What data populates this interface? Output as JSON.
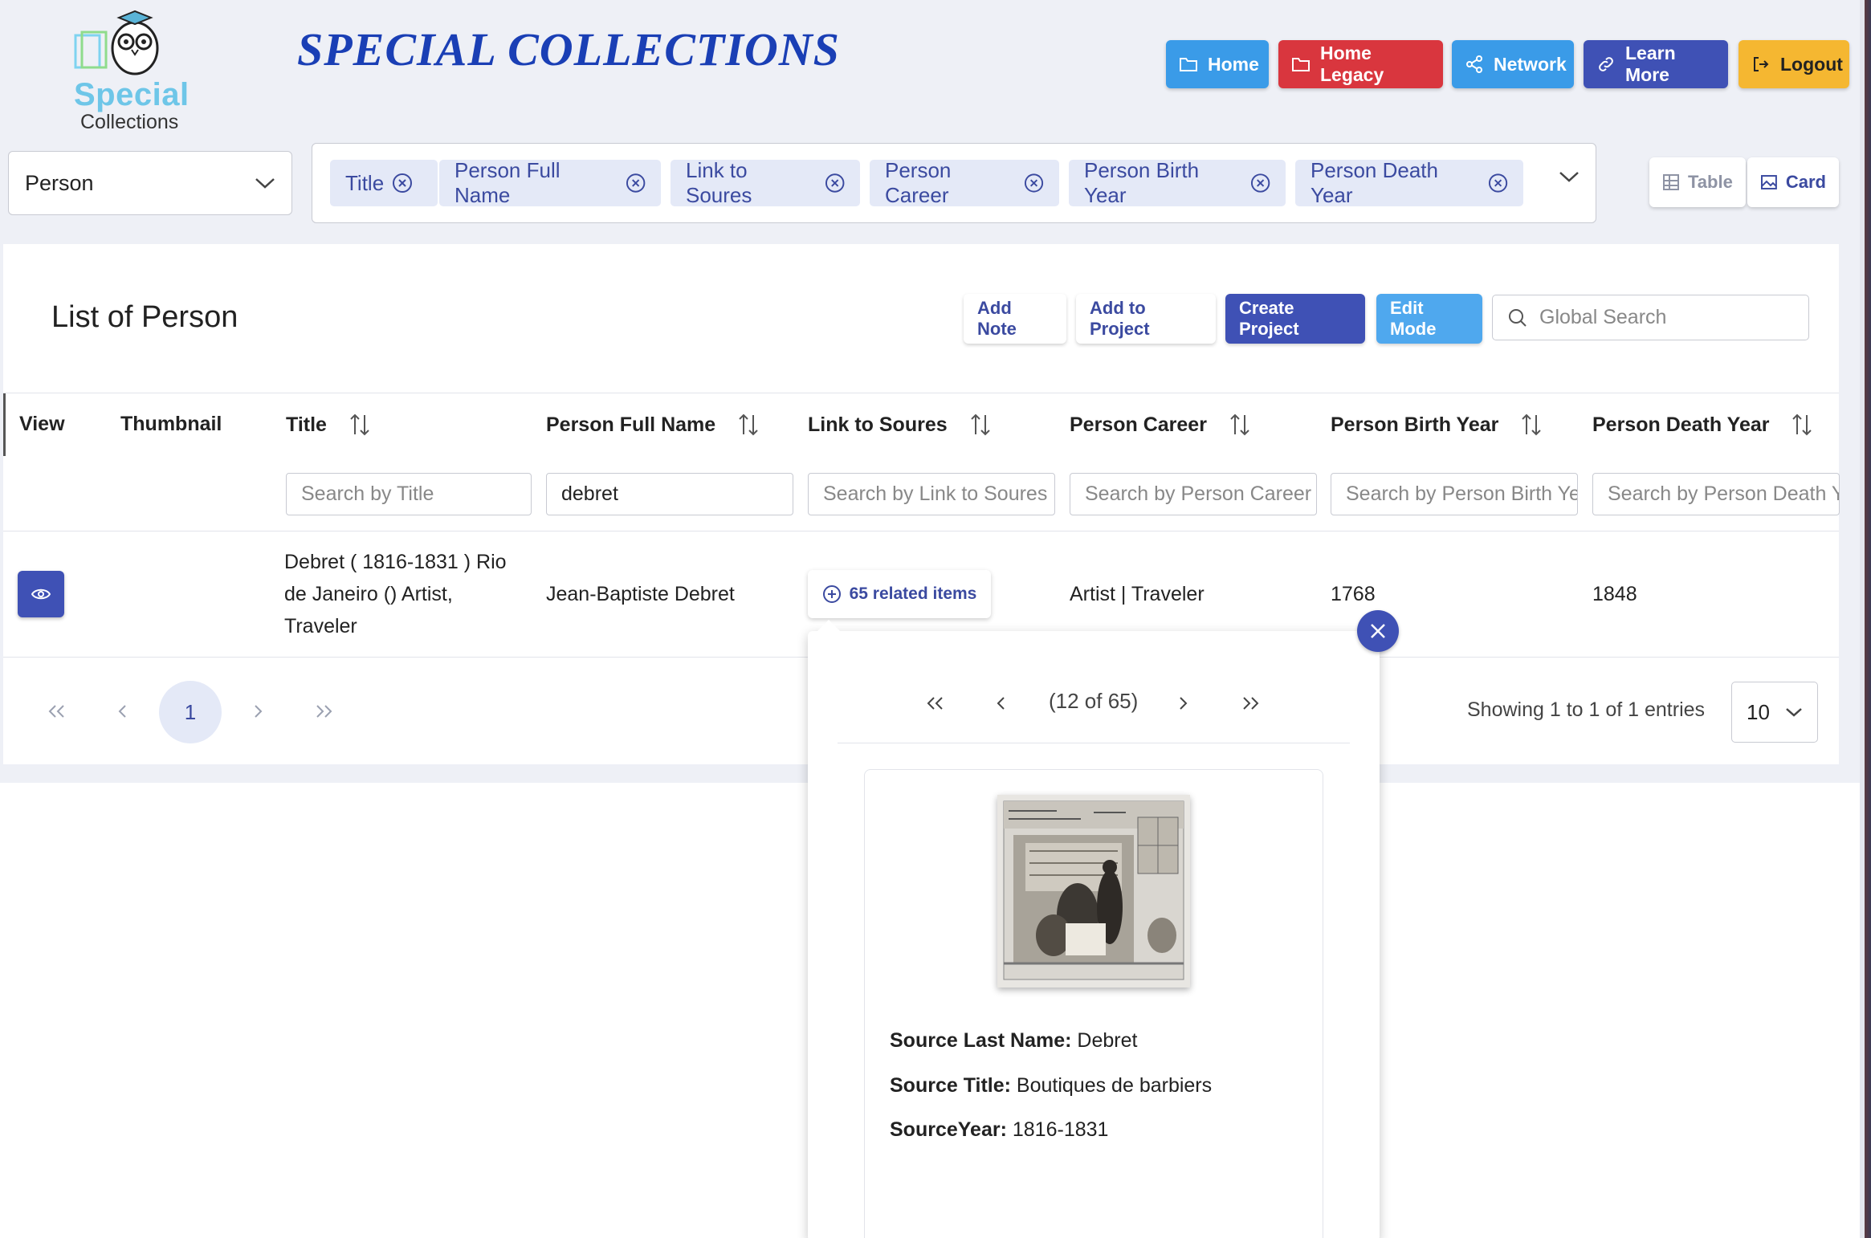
{
  "header": {
    "logo_word": "Special",
    "logo_sub": "Collections",
    "site_title": "SPECIAL COLLECTIONS",
    "nav": [
      {
        "label": "Home",
        "icon": "folder-icon",
        "color": "#3a9be8"
      },
      {
        "label": "Home Legacy",
        "icon": "folder-icon",
        "color": "#d9363e"
      },
      {
        "label": "Network",
        "icon": "share-icon",
        "color": "#3a9be8"
      },
      {
        "label": "Learn More",
        "icon": "link-icon",
        "color": "#3f51b5"
      },
      {
        "label": "Logout",
        "icon": "logout-icon",
        "color": "#f5b731"
      }
    ]
  },
  "toolbar": {
    "entity": "Person",
    "columns_chips": [
      "Title",
      "Person Full Name",
      "Link to Soures",
      "Person Career",
      "Person Birth Year",
      "Person Death Year"
    ],
    "view_table": "Table",
    "view_card": "Card"
  },
  "list": {
    "title": "List of Person",
    "add_note": "Add Note",
    "add_to_project": "Add to Project",
    "create_project": "Create Project",
    "edit_mode": "Edit Mode",
    "global_search_placeholder": "Global Search"
  },
  "table": {
    "headers": {
      "view": "View",
      "thumbnail": "Thumbnail",
      "title": "Title",
      "full_name": "Person Full Name",
      "link": "Link to Soures",
      "career": "Person Career",
      "birth": "Person Birth Year",
      "death": "Person Death Year"
    },
    "filters": {
      "title": "Search by Title",
      "full_name_value": "debret",
      "link": "Search by Link to Soures",
      "career": "Search by Person Career",
      "birth": "Search by Person Birth Ye",
      "death": "Search by Person Death Y"
    },
    "rows": [
      {
        "title_l1": "Debret ( 1816-1831 ) Rio",
        "title_l2": "de Janeiro () Artist,",
        "title_l3": "Traveler",
        "full_name": "Jean-Baptiste Debret",
        "related": "65 related items",
        "career": "Artist | Traveler",
        "birth": "1768",
        "death": "1848"
      }
    ]
  },
  "pager": {
    "current": "1",
    "showing": "Showing 1 to 1 of 1 entries",
    "rows_per_page": "10"
  },
  "overlay": {
    "position": "(12 of 65)",
    "fields": [
      {
        "label": "Source Last Name:",
        "value": "Debret"
      },
      {
        "label": "Source Title:",
        "value": "Boutiques de barbiers"
      },
      {
        "label": "SourceYear:",
        "value": "1816-1831"
      }
    ]
  }
}
